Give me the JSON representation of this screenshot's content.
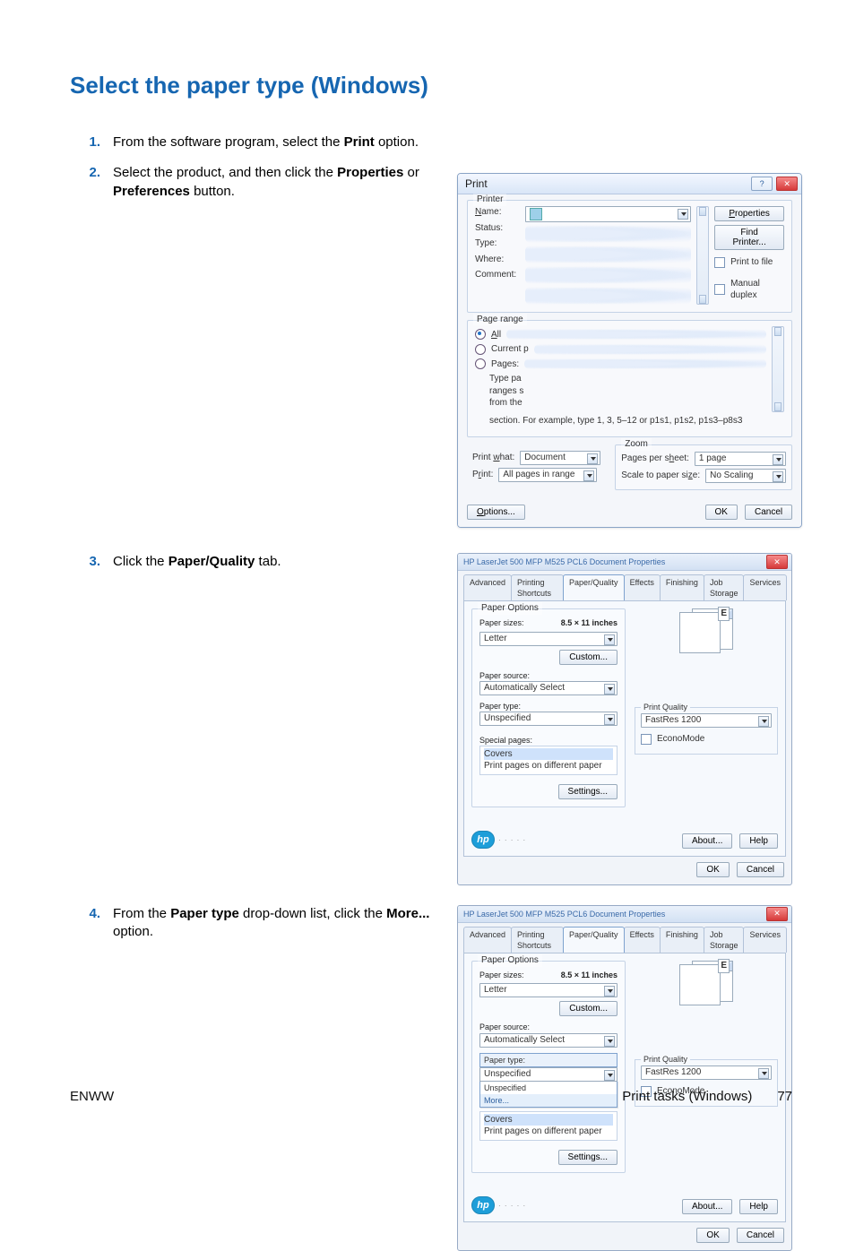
{
  "heading": "Select the paper type (Windows)",
  "steps": {
    "1": {
      "pre": "From the software program, select the ",
      "bold": "Print",
      "post": " option."
    },
    "2": {
      "pre": "Select the product, and then click the ",
      "bold1": "Properties",
      "mid": " or ",
      "bold2": "Preferences",
      "post": " button."
    },
    "3": {
      "pre": "Click the ",
      "bold": "Paper/Quality",
      "post": " tab."
    },
    "4": {
      "pre": "From the ",
      "bold1": "Paper type",
      "mid": " drop-down list, click the ",
      "bold2": "More...",
      "post": " option."
    }
  },
  "footer": {
    "left": "ENWW",
    "right_text": "Print tasks (Windows)",
    "page_number": "77"
  },
  "print_dialog": {
    "title": "Print",
    "groups": {
      "printer": "Printer",
      "page_range": "Page range",
      "zoom": "Zoom"
    },
    "labels": {
      "name": "Name:",
      "status": "Status:",
      "type": "Type:",
      "where": "Where:",
      "comment": "Comment:",
      "all": "All",
      "current": "Current p",
      "pages": "Pages:",
      "type_prefix": "Type pa",
      "ranges_s": "ranges s",
      "from_the": "from the",
      "hint": "section. For example, type 1, 3, 5–12 or p1s1, p1s2, p1s3–p8s3",
      "print_what": "Print what:",
      "print": "Print:",
      "pages_per_sheet": "Pages per sheet:",
      "scale_to_paper": "Scale to paper size:"
    },
    "values": {
      "document": "Document",
      "all_pages_in_range": "All pages in range",
      "one_page": "1 page",
      "no_scaling": "No Scaling"
    },
    "buttons": {
      "properties": "Properties",
      "find_printer": "Find Printer...",
      "print_to_file": "Print to file",
      "manual_duplex": "Manual duplex",
      "options": "Options...",
      "ok": "OK",
      "cancel": "Cancel"
    }
  },
  "props": {
    "title_blur": "HP LaserJet 500 MFP M525 PCL6 Document Properties",
    "tabs": [
      "Advanced",
      "Printing Shortcuts",
      "Paper/Quality",
      "Effects",
      "Finishing",
      "Job Storage",
      "Services"
    ],
    "paper_options_legend": "Paper Options",
    "paper_sizes_label": "Paper sizes:",
    "paper_size_value": "Letter",
    "paper_size_annot": "8.5 × 11 inches",
    "custom_btn": "Custom...",
    "paper_source_label": "Paper source:",
    "paper_source_value": "Automatically Select",
    "paper_type_label": "Paper type:",
    "paper_type_value": "Unspecified",
    "more_value": "More...",
    "special_pages_label": "Special pages:",
    "covers": "Covers",
    "diff_paper": "Print pages on different paper",
    "settings_btn": "Settings...",
    "print_quality_legend": "Print Quality",
    "print_quality_value": "FastRes 1200",
    "economode": "EconoMode",
    "about_btn": "About...",
    "help_btn": "Help",
    "ok_btn": "OK",
    "cancel_btn": "Cancel",
    "hp_logo": "hp"
  }
}
